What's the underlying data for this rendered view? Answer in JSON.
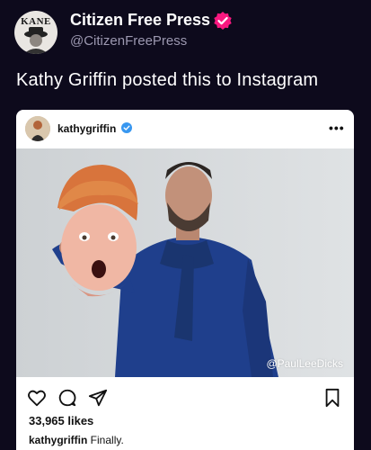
{
  "tweet": {
    "display_name": "Citizen Free Press",
    "handle": "@CitizenFreePress",
    "text": "Kathy Griffin posted this to Instagram",
    "avatar_text": "KANE",
    "verified_color": "#f91880"
  },
  "instagram": {
    "username": "kathygriffin",
    "more_label": "•••",
    "watermark": "@PaulLeeDicks",
    "likes": "33,965 likes",
    "caption_user": "kathygriffin",
    "caption_text": " Finally.",
    "verified_color": "#3897f0"
  },
  "icons": [
    "heart-icon",
    "comment-icon",
    "share-icon",
    "bookmark-icon"
  ]
}
